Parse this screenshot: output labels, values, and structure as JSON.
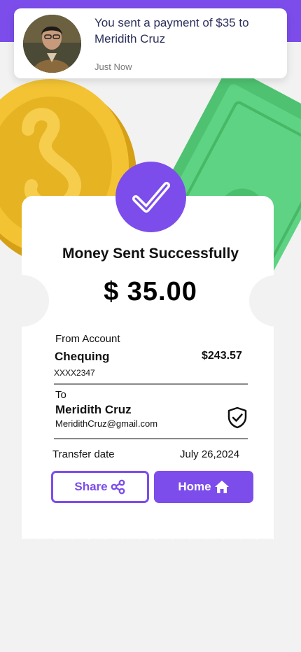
{
  "colors": {
    "accent": "#7c4deb",
    "background": "#f2f2f2",
    "coin": "#f1c232",
    "cash": "#5ed383"
  },
  "notification": {
    "message": "You sent a payment of $35 to Meridith Cruz",
    "time": "Just Now"
  },
  "receipt": {
    "title": "Money Sent Successfully",
    "amount": "$ 35.00",
    "from": {
      "label": "From Account",
      "account_name": "Chequing",
      "balance": "$243.57",
      "account_number": "XXXX2347"
    },
    "to": {
      "label": "To",
      "name": "Meridith Cruz",
      "email": "MeridithCruz@gmail.com"
    },
    "transfer_date": {
      "label": "Transfer date",
      "value": "July 26,2024"
    }
  },
  "actions": {
    "share_label": "Share",
    "home_label": "Home"
  },
  "icons": [
    "check-icon",
    "verified-shield-icon",
    "share-icon",
    "home-icon"
  ]
}
